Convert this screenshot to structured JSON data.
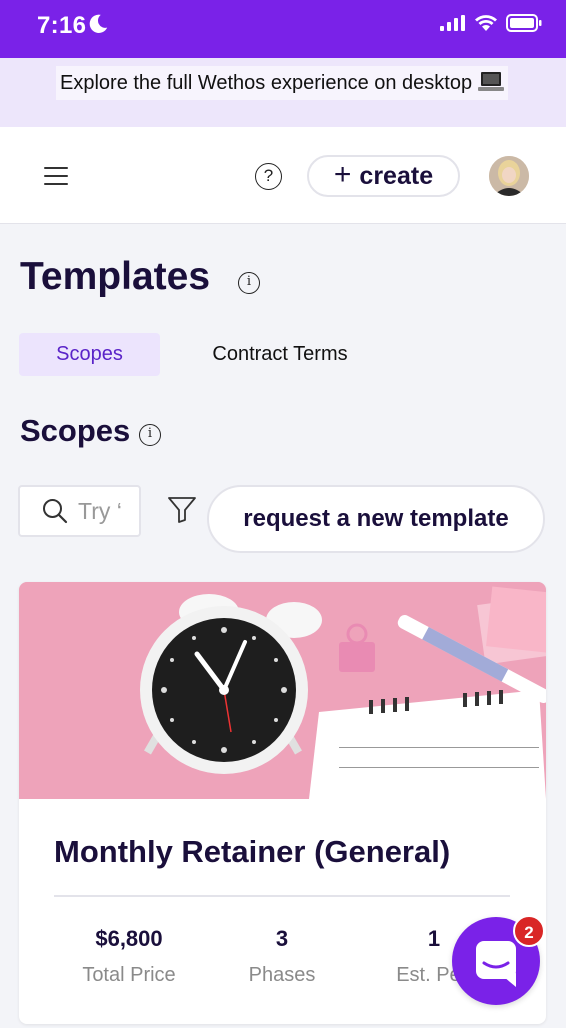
{
  "status_bar": {
    "time": "7:16"
  },
  "banner": {
    "text": "Explore the full Wethos experience on desktop"
  },
  "header": {
    "create_label": "create",
    "help_glyph": "?"
  },
  "page": {
    "title": "Templates",
    "info_glyph": "i"
  },
  "tabs": [
    {
      "label": "Scopes",
      "active": true
    },
    {
      "label": "Contract Terms",
      "active": false
    }
  ],
  "section": {
    "title": "Scopes",
    "info_glyph": "i"
  },
  "search": {
    "placeholder": "Try ‘"
  },
  "request_button": {
    "label": "request a new template"
  },
  "card": {
    "title": "Monthly Retainer (General)",
    "stats": [
      {
        "value": "$6,800",
        "label": "Total Price"
      },
      {
        "value": "3",
        "label": "Phases"
      },
      {
        "value": "1",
        "label": "Est. Peo"
      }
    ]
  },
  "chat": {
    "badge_count": "2"
  },
  "colors": {
    "accent": "#7a22e8",
    "tab_active_bg": "#ece4fd",
    "badge": "#d92626",
    "title": "#1a0f3b"
  }
}
